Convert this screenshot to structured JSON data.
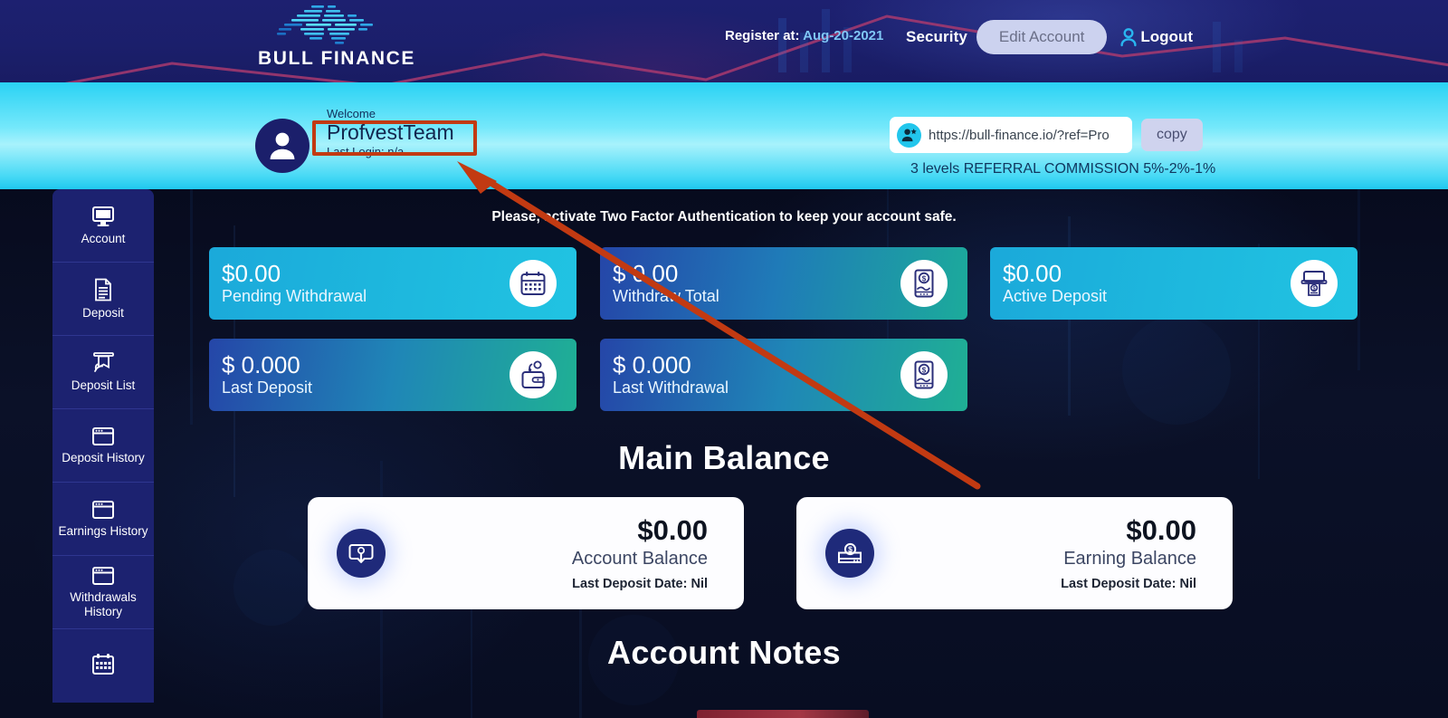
{
  "brand": {
    "name": "BULL FINANCE",
    "logo_icon": "pixel-bull-logo-icon"
  },
  "topnav": {
    "register_label": "Register at:",
    "register_date": "Aug-20-2021",
    "security_label": "Security",
    "edit_account_label": "Edit Account",
    "logout_label": "Logout",
    "logout_icon": "user-icon"
  },
  "banner": {
    "avatar_icon": "user-avatar-icon",
    "welcome_label": "Welcome",
    "username": "ProfvestTeam",
    "last_login": "Last Login: n/a",
    "referral": {
      "icon": "referral-user-star-icon",
      "url": "https://bull-finance.io/?ref=Pro",
      "copy_label": "copy",
      "commission_note": "3 levels REFERRAL COMMISSION 5%-2%-1%"
    }
  },
  "sidebar": {
    "items": [
      {
        "label": "Account",
        "icon": "monitor-icon"
      },
      {
        "label": "Deposit",
        "icon": "document-list-icon"
      },
      {
        "label": "Deposit List",
        "icon": "hand-receipt-icon"
      },
      {
        "label": "Deposit History",
        "icon": "window-icon"
      },
      {
        "label": "Earnings History",
        "icon": "window-icon"
      },
      {
        "label": "Withdrawals History",
        "icon": "window-icon"
      },
      {
        "label": "",
        "icon": "calendar-icon"
      }
    ]
  },
  "main": {
    "twofa_notice": "Please, activate Two Factor Authentication to keep your account safe.",
    "stat_cards": [
      {
        "value": "$0.00",
        "label": "Pending Withdrawal",
        "icon": "calendar-icon"
      },
      {
        "value": "$ 0.00",
        "label": "Withdraw Total",
        "icon": "mobile-payment-icon"
      },
      {
        "value": "$0.00",
        "label": "Active Deposit",
        "icon": "atm-icon"
      },
      {
        "value": "$ 0.000",
        "label": "Last Deposit",
        "icon": "wallet-icon"
      },
      {
        "value": "$ 0.000",
        "label": "Last Withdrawal",
        "icon": "mobile-payment-icon"
      }
    ],
    "main_balance_title": "Main Balance",
    "balance_cards": [
      {
        "value": "$0.00",
        "label": "Account Balance",
        "sub": "Last Deposit Date: Nil",
        "icon": "card-deposit-icon"
      },
      {
        "value": "$0.00",
        "label": "Earning Balance",
        "sub": "Last Deposit Date: Nil",
        "icon": "coin-tray-icon"
      }
    ],
    "account_notes_title": "Account Notes"
  },
  "colors": {
    "nav_navy": "#1b1f6b",
    "banner_cyan": "#46d9f5",
    "card_cyan": "#1db6dd",
    "card_gradient_start": "#2546a8",
    "card_gradient_end": "#1fb094",
    "accent_navy": "#1f2a7a",
    "annotation_red": "#c23a12",
    "page_dark": "#0a0e24"
  }
}
